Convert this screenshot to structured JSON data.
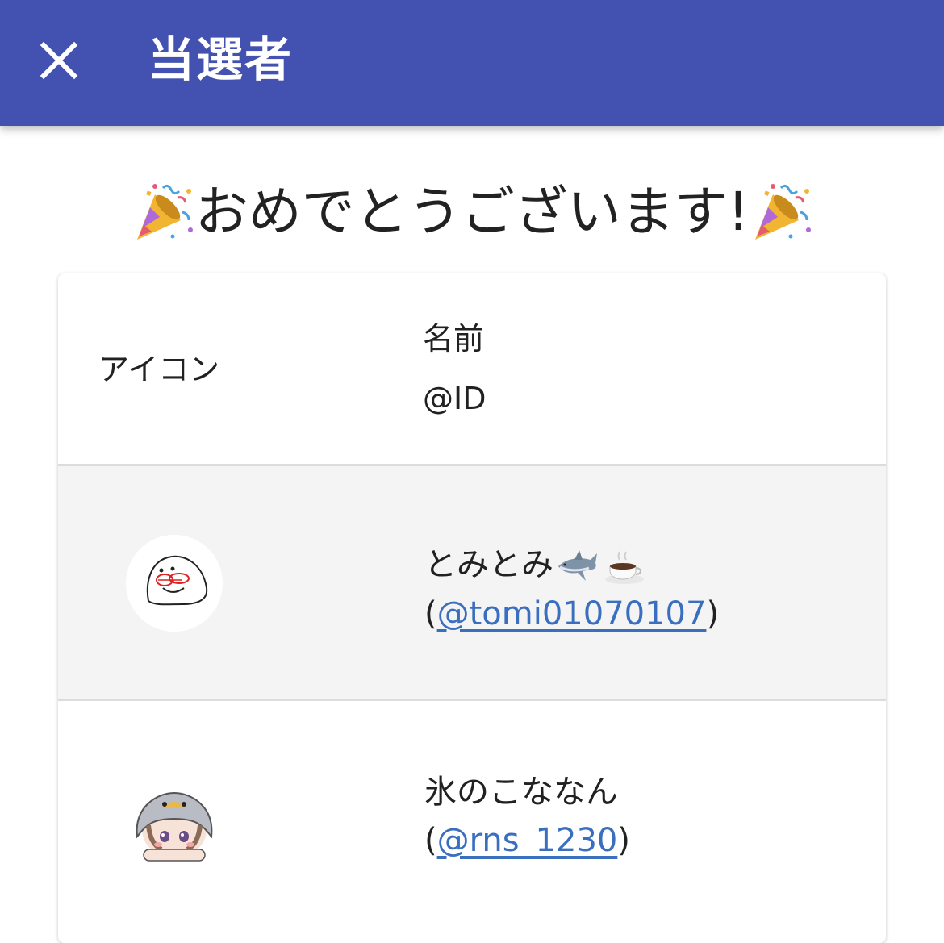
{
  "appbar": {
    "title": "当選者",
    "close_icon": "close-icon",
    "color": "#4352b0"
  },
  "congrats": {
    "text": "おめでとうございます!",
    "left_icon": "party-popper-icon",
    "right_icon": "party-popper-icon"
  },
  "table": {
    "headers": {
      "icon": "アイコン",
      "name": "名前",
      "id": "@ID"
    },
    "rows": [
      {
        "name": "とみとみ",
        "name_icons": [
          "shark-icon",
          "coffee-icon"
        ],
        "id_open": "(",
        "id": "@tomi01070107",
        "id_close": ")",
        "avatar": "avatar-blob-drawing"
      },
      {
        "name": "氷のこななん",
        "name_icons": [],
        "id_open": "(",
        "id": "@rns_1230",
        "id_close": ")",
        "avatar": "avatar-penguin-hood-girl"
      }
    ]
  },
  "colors": {
    "link": "#3a6fc0",
    "row_highlight": "#f4f4f4"
  }
}
